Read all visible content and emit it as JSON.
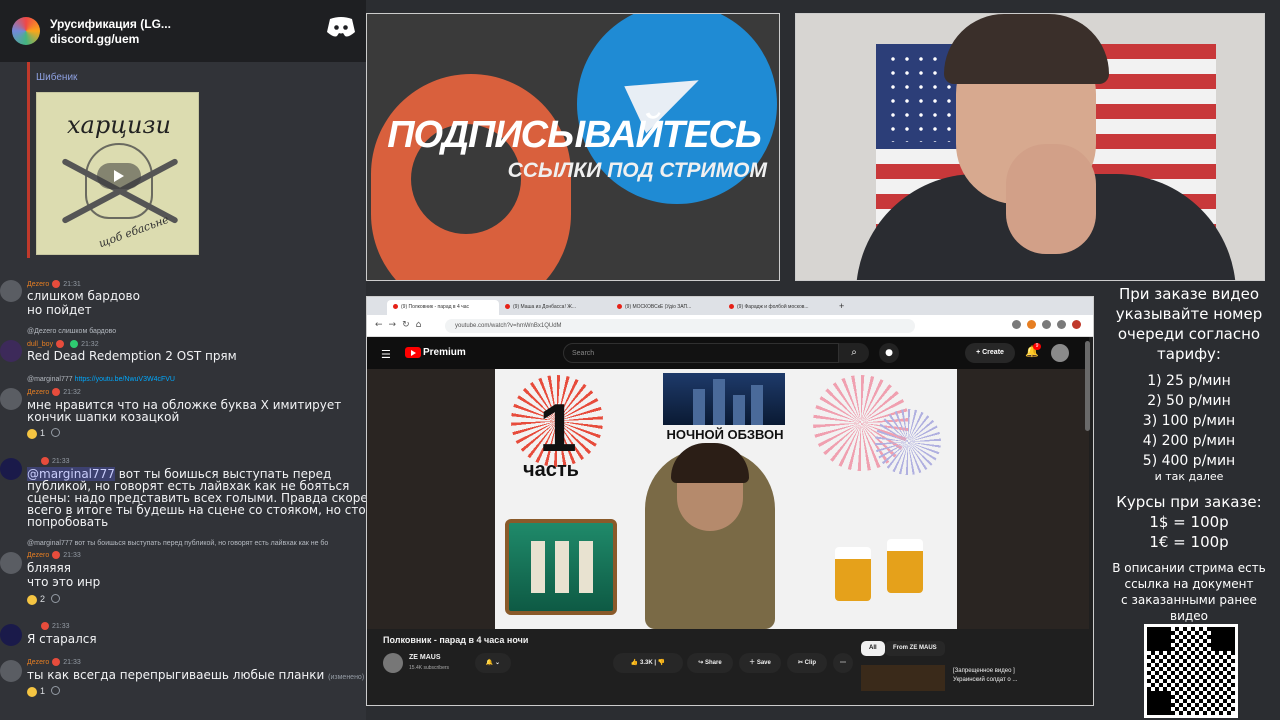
{
  "discord": {
    "server_name": "Урусификация (LG...",
    "invite": "discord.gg/uem",
    "prev_author": "Шибеник",
    "album_title": "харцизи",
    "album_sub": "щоб ебасьне",
    "messages": [
      {
        "author": "Дezero",
        "time": "21:31",
        "lines": [
          "слишком бардово",
          "но пойдет"
        ]
      },
      {
        "reply": "@Дezero слишком бардово",
        "author": "dull_boy",
        "time": "21:32",
        "lines": [
          "Red Dead Redemption 2 OST прям"
        ]
      },
      {
        "reply": "@marginal777",
        "reply_link": "https://youtu.be/NwuV3W4cFVU",
        "author": "Дezero",
        "time": "21:32",
        "lines": [
          "мне нравится что на обложке буква Х имитирует",
          "кончик шапки козацкой"
        ],
        "reactions": [
          {
            "count": "1"
          }
        ]
      },
      {
        "author": "",
        "time": "21:33",
        "mention": "@marginal777",
        "lines": [
          " вот ты боишься выступать перед",
          "публикой, но говорят есть лайвхак как не бояться",
          "сцены: надо представить всех голыми. Правда скорее",
          "всего в итоге ты будешь на сцене со стояком, но стоит",
          "попробовать"
        ]
      },
      {
        "reply": "@marginal777 вот ты боишься выступать перед публикой, но говорят есть лайвхак как не бо",
        "author": "Дezero",
        "time": "21:33",
        "lines": [
          "бляяяя",
          "что это инр"
        ],
        "reactions": [
          {
            "count": "2"
          }
        ]
      },
      {
        "author": "",
        "time": "21:33",
        "lines": [
          "Я старался"
        ]
      },
      {
        "author": "Дezero",
        "time": "21:33",
        "lines": [
          "ты как всегда перепрыгиваешь любые планки"
        ],
        "edited": "(изменено)",
        "reactions": [
          {
            "count": "1"
          }
        ]
      }
    ]
  },
  "promo": {
    "headline": "ПОДПИСЫВАЙТЕСЬ",
    "subline": "ССЫЛКИ ПОД СТРИМОМ",
    "colors": {
      "red": "#d9603d",
      "blue": "#1f8bd4"
    }
  },
  "browser": {
    "tabs": [
      "(9) Полковник - парад в 4 час",
      "(9) Маша из Донбасса! Ж...",
      "(9) МОСКОВСкЕ (Удio ЗАП...",
      "(9) Фарадж и фолбой москов..."
    ],
    "url": "youtube.com/watch?v=hmWnBx1QUdM",
    "yt": {
      "brand": "Premium",
      "search_placeholder": "Search",
      "create_label": "Create",
      "notif_count": "9",
      "video": {
        "thumb_1": "1",
        "thumb_part": "часть",
        "thumb_night": "НОЧНОЙ ОБЗВОН",
        "title": "Полковник - парад в 4 часа ночи",
        "channel": "ZE MAUS",
        "subs": "15.4K subscribers",
        "likes": "3.3K",
        "share": "Share",
        "save": "Save",
        "clip": "Clip"
      },
      "chips": [
        "All",
        "From ZE MAUS"
      ],
      "suggested": {
        "title_line1": "[Запрещенное видео ]",
        "title_line2": "Украинский солдат о ..."
      }
    }
  },
  "info": {
    "order_text": [
      "При заказе видео",
      "указывайте номер",
      "очереди согласно",
      "тарифу:"
    ],
    "tariffs": [
      "1) 25 р/мин",
      "2) 50 р/мин",
      "3) 100 р/мин",
      "4) 200 р/мин",
      "5) 400 р/мин"
    ],
    "etc": "и так далее",
    "rates_title": "Курсы при заказе:",
    "rates": [
      "1$ = 100р",
      "1€ = 100р"
    ],
    "note": [
      "В описании стрима есть",
      "ссылка на документ",
      "с заказанными ранее",
      "видео"
    ]
  }
}
